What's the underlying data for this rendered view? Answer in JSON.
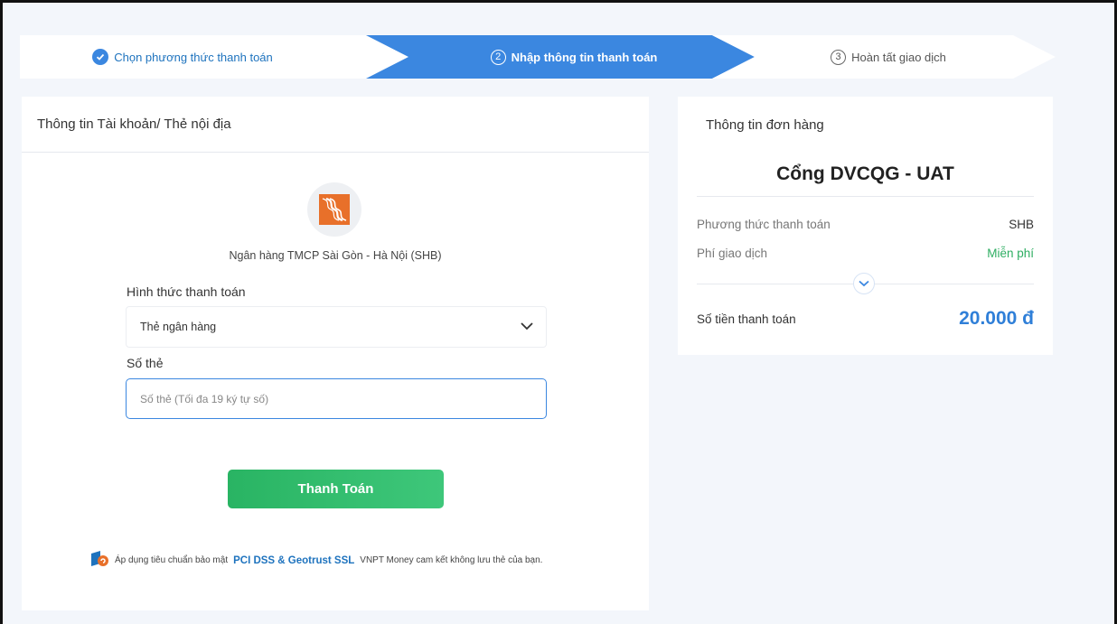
{
  "steps": [
    {
      "label": "Chọn phương thức thanh toán",
      "state": "done"
    },
    {
      "number": "2",
      "label": "Nhập thông tin thanh toán",
      "state": "active"
    },
    {
      "number": "3",
      "label": "Hoàn tất giao dịch",
      "state": "pending"
    }
  ],
  "payment_form": {
    "title": "Thông tin Tài khoản/ Thẻ nội địa",
    "bank_name": "Ngân hàng TMCP Sài Gòn - Hà Nội (SHB)",
    "method_label": "Hình thức thanh toán",
    "method_value": "Thẻ ngân hàng",
    "card_label": "Số thẻ",
    "card_placeholder": "Số thẻ (Tối đa 19 ký tự số)",
    "card_value": "",
    "submit_label": "Thanh Toán",
    "security_prefix": "Áp dụng tiêu chuẩn bảo mật",
    "security_highlight": "PCI DSS & Geotrust SSL",
    "security_suffix": "VNPT Money cam kết không lưu thẻ của bạn."
  },
  "order": {
    "title": "Thông tin đơn hàng",
    "merchant": "Cổng DVCQG - UAT",
    "method_label": "Phương thức thanh toán",
    "method_value": "SHB",
    "fee_label": "Phí giao dịch",
    "fee_value": "Miễn phí",
    "total_label": "Số tiền thanh toán",
    "total_value": "20.000 đ"
  },
  "colors": {
    "accent": "#3b87e0",
    "success": "#29b463",
    "amount": "#2f7fd8",
    "bank_logo": "#e8702a"
  },
  "icons": {
    "step_done": "check-circle-icon",
    "select": "chevron-down-icon",
    "expand": "chevron-down-circle-icon",
    "security": "vnpt-money-logo-icon",
    "bank": "shb-logo-icon"
  }
}
